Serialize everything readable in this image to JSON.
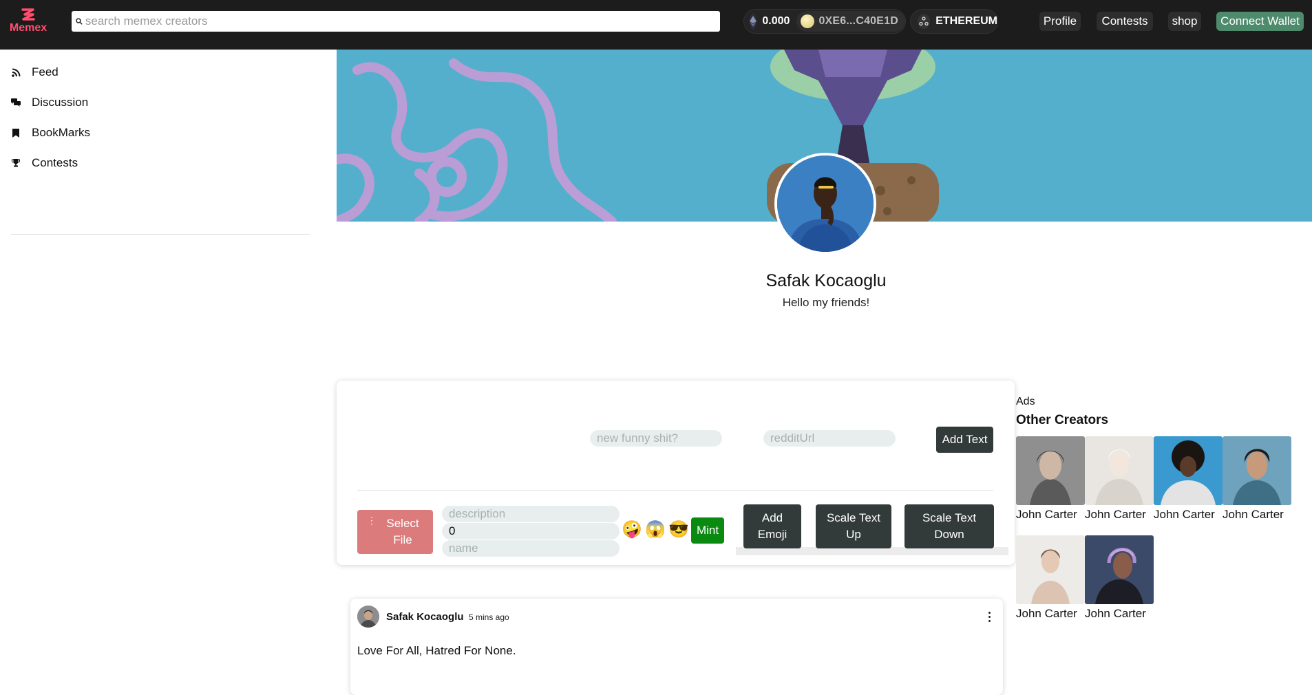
{
  "brand": {
    "name": "Memex",
    "color": "#ff4d6d"
  },
  "header": {
    "search_placeholder": "search memex creators",
    "balance": "0.000",
    "address": "0XE6...C40E1D",
    "network": "ETHEREUM",
    "nav": {
      "profile": "Profile",
      "contests": "Contests",
      "shop": "shop",
      "connect": "Connect Wallet"
    }
  },
  "sidebar": {
    "items": [
      {
        "label": "Feed",
        "icon": "rss-icon"
      },
      {
        "label": "Discussion",
        "icon": "chat-bubbles-icon"
      },
      {
        "label": "BookMarks",
        "icon": "bookmark-icon"
      },
      {
        "label": "Contests",
        "icon": "trophy-icon"
      }
    ]
  },
  "profile": {
    "name": "Safak Kocaoglu",
    "bio": "Hello my friends!"
  },
  "composer": {
    "text_placeholder": "new funny shit?",
    "reddit_placeholder": "redditUrl",
    "add_text": "Add Text",
    "select_file": "Select File",
    "description_placeholder": "description",
    "amount_value": "0",
    "name_placeholder": "name",
    "emojis": [
      "🤪",
      "😱",
      "😎"
    ],
    "mint": "Mint",
    "add_emoji": "Add Emoji",
    "scale_up": "Scale Text Up",
    "scale_down": "Scale Text Down"
  },
  "ads": {
    "label": "Ads",
    "title": "Other Creators",
    "creators": [
      {
        "name": "John Carter"
      },
      {
        "name": "John Carter"
      },
      {
        "name": "John Carter"
      },
      {
        "name": "John Carter"
      },
      {
        "name": "John Carter"
      },
      {
        "name": "John Carter"
      }
    ]
  },
  "post": {
    "author": "Safak Kocaoglu",
    "time": "5 mins ago",
    "text": "Love For All, Hatred For None."
  },
  "colors": {
    "topbar": "#1c1c1c",
    "connect": "#4e8a6c",
    "mint": "#0b8a11",
    "select_file": "#db7b7b"
  }
}
